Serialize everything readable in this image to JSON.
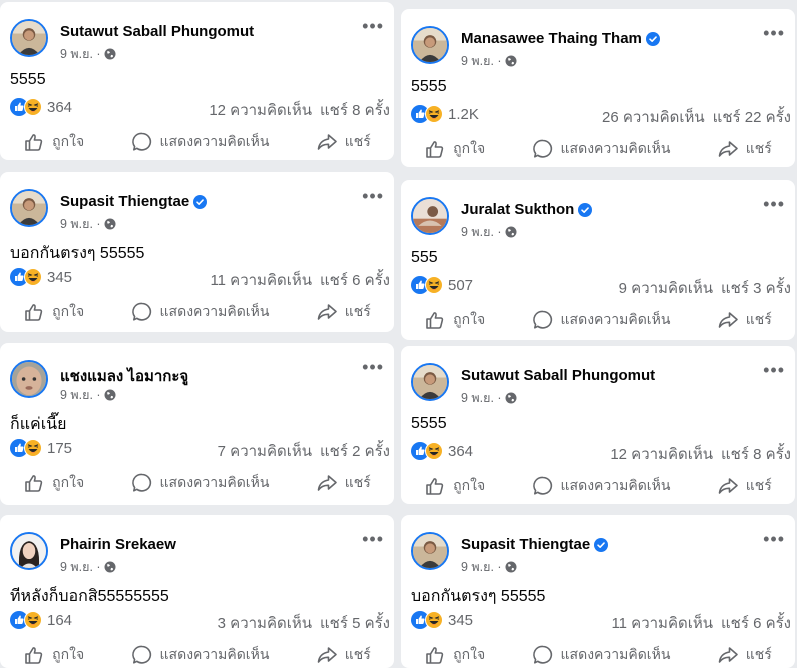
{
  "labels": {
    "like": "ถูกใจ",
    "comment": "แสดงความคิดเห็น",
    "share": "แชร์"
  },
  "colors": {
    "accent": "#1877f2",
    "secondary_text": "#65676b",
    "haha": "#f7b125"
  },
  "posts_left": [
    {
      "name": "Sutawut Saball Phungomut",
      "verified": false,
      "avatar": "man-photo",
      "date": "9 พ.ย. ·",
      "text": "5555",
      "reaction_count": "364",
      "comments": "12 ความคิดเห็น",
      "shares": "แชร์ 8 ครั้ง"
    },
    {
      "name": "Supasit Thiengtae",
      "verified": true,
      "avatar": "man-photo",
      "date": "9 พ.ย. ·",
      "text": "บอกกันตรงๆ 55555",
      "reaction_count": "345",
      "comments": "11 ความคิดเห็น",
      "shares": "แชร์ 6 ครั้ง"
    },
    {
      "name": "แชงแมลง ไอมากะจู",
      "verified": false,
      "avatar": "face-photo",
      "date": "9 พ.ย. ·",
      "text": "ก็แค่เนี๊ย",
      "reaction_count": "175",
      "comments": "7 ความคิดเห็น",
      "shares": "แชร์ 2 ครั้ง"
    },
    {
      "name": "Phairin Srekaew",
      "verified": false,
      "avatar": "woman-photo",
      "date": "9 พ.ย. ·",
      "text": "ทีหลังก็บอกสิ55555555",
      "reaction_count": "164",
      "comments": "3 ความคิดเห็น",
      "shares": "แชร์ 5 ครั้ง"
    }
  ],
  "posts_right": [
    {
      "name": "Manasawee Thaing Tham",
      "verified": true,
      "avatar": "man-photo",
      "date": "9 พ.ย. ·",
      "text": "5555",
      "reaction_count": "1.2K",
      "comments": "26 ความคิดเห็น",
      "shares": "แชร์ 22 ครั้ง"
    },
    {
      "name": "Juralat Sukthon",
      "verified": true,
      "avatar": "cat-photo",
      "date": "9 พ.ย. ·",
      "text": "555",
      "reaction_count": "507",
      "comments": "9 ความคิดเห็น",
      "shares": "แชร์ 3 ครั้ง"
    },
    {
      "name": "Sutawut Saball Phungomut",
      "verified": false,
      "avatar": "man-photo",
      "date": "9 พ.ย. ·",
      "text": "5555",
      "reaction_count": "364",
      "comments": "12 ความคิดเห็น",
      "shares": "แชร์ 8 ครั้ง"
    },
    {
      "name": "Supasit Thiengtae",
      "verified": true,
      "avatar": "man-photo",
      "date": "9 พ.ย. ·",
      "text": "บอกกันตรงๆ 55555",
      "reaction_count": "345",
      "comments": "11 ความคิดเห็น",
      "shares": "แชร์ 6 ครั้ง"
    }
  ]
}
